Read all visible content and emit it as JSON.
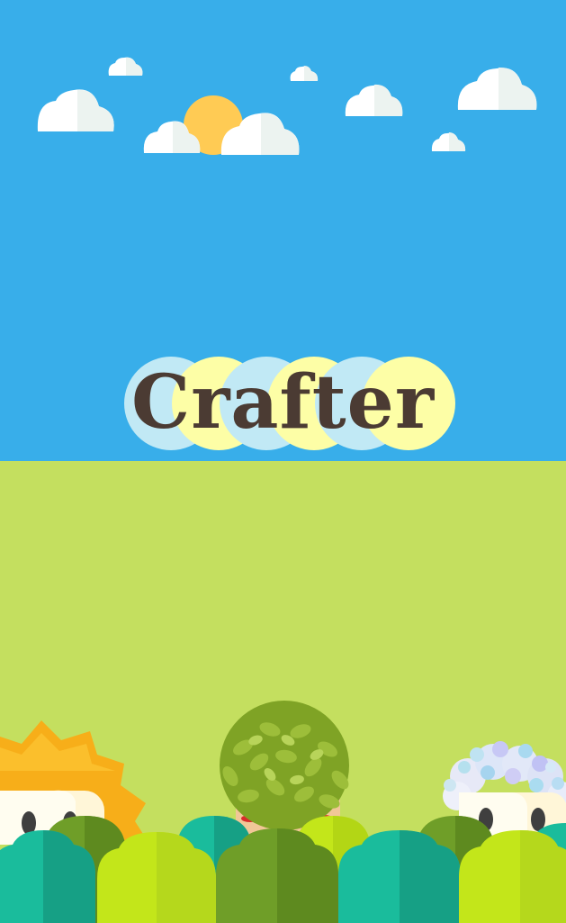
{
  "game": {
    "title": "Crafter"
  },
  "colors": {
    "sky": "#38AEEA",
    "grass": "#C4DF5F",
    "sun": "#FFCB54",
    "cloud": "#FFFFFF",
    "cloud_shade": "#ECF3F0",
    "title_text": "#4B3B33",
    "title_circle_blue": "#C1E9F5",
    "title_circle_yellow": "#FDFEA6",
    "bush_teal": "#1ABC9C",
    "bush_green": "#6F9E28",
    "bush_lime": "#C3E61A"
  },
  "characters": [
    "lion-character",
    "leafy-character",
    "bubble-character"
  ]
}
